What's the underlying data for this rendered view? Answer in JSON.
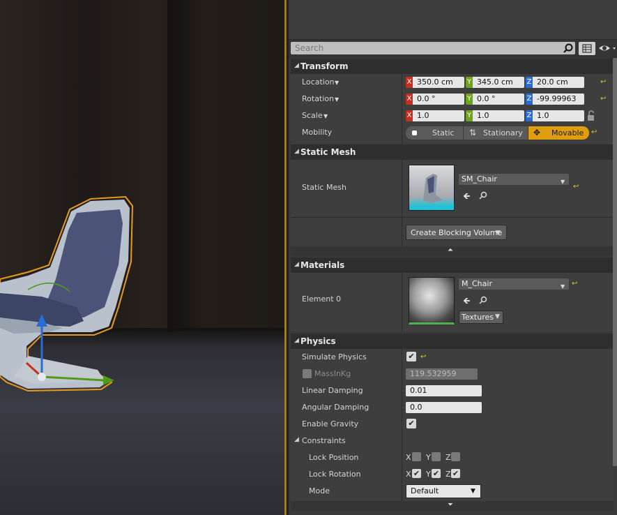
{
  "search": {
    "placeholder": "Search"
  },
  "transform": {
    "title": "Transform",
    "location": {
      "label": "Location",
      "x": "350.0 cm",
      "y": "345.0 cm",
      "z": "20.0 cm"
    },
    "rotation": {
      "label": "Rotation",
      "x": "0.0 °",
      "y": "0.0 °",
      "z": "-99.99963"
    },
    "scale": {
      "label": "Scale",
      "x": "1.0",
      "y": "1.0",
      "z": "1.0"
    },
    "mobility": {
      "label": "Mobility",
      "options": [
        "Static",
        "Stationary",
        "Movable"
      ],
      "selected": "Movable"
    },
    "axis_x": "X",
    "axis_y": "Y",
    "axis_z": "Z"
  },
  "static_mesh": {
    "title": "Static Mesh",
    "label": "Static Mesh",
    "value": "SM_Chair",
    "blocking_button": "Create Blocking Volume"
  },
  "materials": {
    "title": "Materials",
    "element_label": "Element 0",
    "value": "M_Chair",
    "textures_button": "Textures"
  },
  "physics": {
    "title": "Physics",
    "simulate_physics": {
      "label": "Simulate Physics",
      "checked": true
    },
    "mass": {
      "label": "MassInKg",
      "value": "119.532959",
      "enabled": false
    },
    "linear_damping": {
      "label": "Linear Damping",
      "value": "0.01"
    },
    "angular_damping": {
      "label": "Angular Damping",
      "value": "0.0"
    },
    "enable_gravity": {
      "label": "Enable Gravity",
      "checked": true
    },
    "constraints": {
      "title": "Constraints",
      "lock_position": {
        "label": "Lock Position",
        "x": false,
        "y": false,
        "z": false
      },
      "lock_rotation": {
        "label": "Lock Rotation",
        "x": true,
        "y": true,
        "z": true
      },
      "mode": {
        "label": "Mode",
        "value": "Default"
      }
    }
  },
  "colors": {
    "accent": "#e09d0d",
    "axis_x": "#c4301d",
    "axis_y": "#6fa31b",
    "axis_z": "#2a6cd6",
    "reset": "#e4c629"
  }
}
